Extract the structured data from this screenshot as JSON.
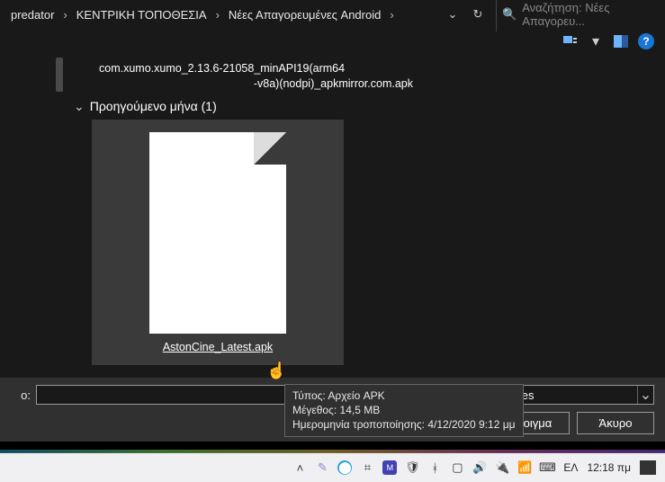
{
  "breadcrumb": {
    "items": [
      "predator",
      "ΚΕΝΤΡΙΚΗ ΤΟΠΟΘΕΣΙΑ",
      "Νέες Απαγορευμένες Android"
    ]
  },
  "search": {
    "placeholder": "Αναζήτηση: Νέες Απαγορευ..."
  },
  "prev_file_line1": "com.xumo.xumo_2.13.6-21058_minAPI19(arm64",
  "prev_file_line2": "-v8a)(nodpi)_apkmirror.com.apk",
  "group": {
    "label": "Προηγούμενο μήνα (1)"
  },
  "file": {
    "name": "AstonCine_Latest.apk"
  },
  "tooltip": {
    "type_label": "Τύπος:",
    "type_value": "Αρχείο APK",
    "size_label": "Μέγεθος:",
    "size_value": "14,5 MB",
    "date_label": "Ημερομηνία τροποποίησης:",
    "date_value": "4/12/2020 9:12 μμ"
  },
  "bottom": {
    "name_label": "ο:",
    "combo_value": "",
    "filter_selected": "All Files",
    "open_btn": "Άνοιγμα",
    "cancel_btn": "Άκυρο"
  },
  "taskbar": {
    "lang": "ΕΛ",
    "time": "12:18 πμ"
  }
}
